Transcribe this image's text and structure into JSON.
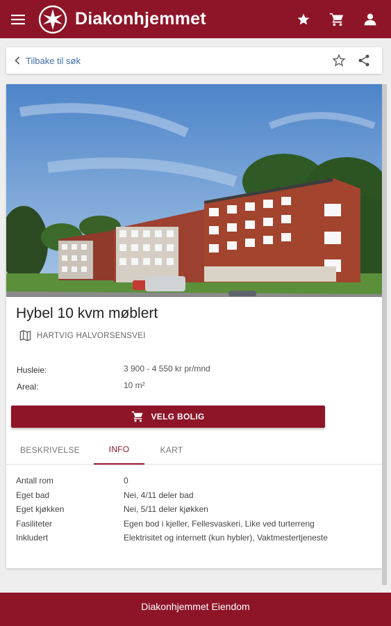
{
  "header": {
    "brand": "Diakonhjemmet"
  },
  "nav": {
    "back_label": "Tilbake til søk"
  },
  "listing": {
    "title": "Hybel 10 kvm møblert",
    "address": "HARTVIG HALVORSENSVEI",
    "details": [
      {
        "label": "Husleie:",
        "value": "3 900 - 4 550 kr pr/mnd"
      },
      {
        "label": "Areal:",
        "value": "10 m²"
      }
    ],
    "cta_label": "VELG BOLIG"
  },
  "tabs": [
    {
      "label": "BESKRIVELSE",
      "active": false
    },
    {
      "label": "INFO",
      "active": true
    },
    {
      "label": "KART",
      "active": false
    }
  ],
  "info": [
    {
      "label": "Antall rom",
      "value": "0"
    },
    {
      "label": "Eget bad",
      "value": "Nei, 4/11 deler bad"
    },
    {
      "label": "Eget kjøkken",
      "value": "Nei, 5/11 deler kjøkken"
    },
    {
      "label": "Fasiliteter",
      "value": "Egen bod i kjeller, Fellesvaskeri, Like ved turterreng"
    },
    {
      "label": "Inkludert",
      "value": "Elektrisitet og internett (kun hybler), Vaktmestertjeneste"
    }
  ],
  "footer": {
    "title": "Diakonhjemmet Eiendom"
  },
  "colors": {
    "brand": "#8e1528",
    "link": "#3e6ea8"
  },
  "icons": [
    "menu-icon",
    "cross-logo",
    "star-icon",
    "cart-icon",
    "person-icon",
    "chevron-left-icon",
    "star-outline-icon",
    "share-icon",
    "map-icon"
  ]
}
